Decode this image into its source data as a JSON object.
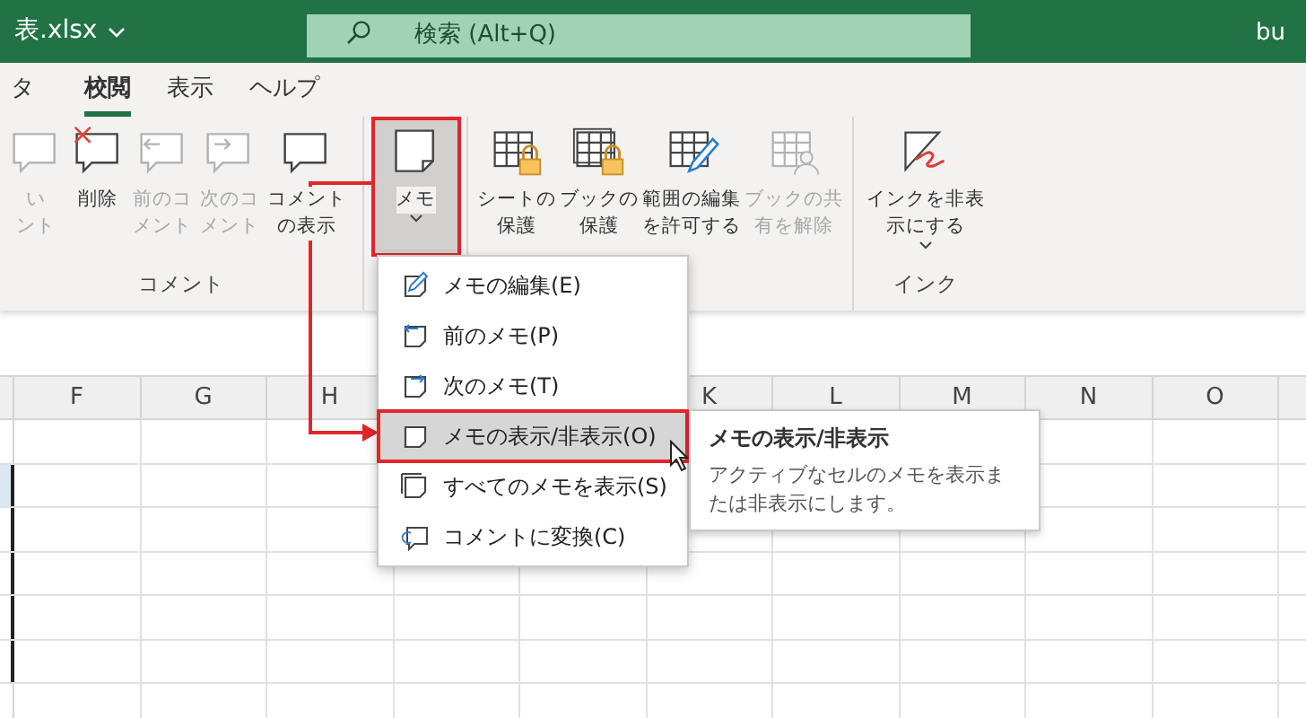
{
  "title_bar": {
    "file_name": "表.xlsx",
    "search": {
      "placeholder": "検索 (Alt+Q)"
    },
    "user": "bu"
  },
  "tabs": [
    {
      "label": "タ",
      "selected": false
    },
    {
      "label": "校閲",
      "selected": true
    },
    {
      "label": "表示",
      "selected": false
    },
    {
      "label": "ヘルプ",
      "selected": false
    }
  ],
  "ribbon_groups": [
    {
      "label": "コメント",
      "buttons": [
        {
          "kind": "comment-new",
          "lines": [
            "い",
            "ント"
          ],
          "disabled": true,
          "pressed": false,
          "dropdown": false
        },
        {
          "kind": "comment-delete",
          "lines": [
            "削除"
          ],
          "disabled": false,
          "pressed": false,
          "dropdown": false
        },
        {
          "kind": "comment-prev",
          "lines": [
            "前のコ",
            "メント"
          ],
          "disabled": true,
          "pressed": false,
          "dropdown": false
        },
        {
          "kind": "comment-next",
          "lines": [
            "次のコ",
            "メント"
          ],
          "disabled": true,
          "pressed": false,
          "dropdown": false
        },
        {
          "kind": "comment",
          "lines": [
            "コメント",
            "の表示"
          ],
          "disabled": false,
          "pressed": false,
          "dropdown": false
        }
      ]
    },
    {
      "buttons": [
        {
          "kind": "note",
          "lines": [
            "メモ"
          ],
          "disabled": false,
          "pressed": true,
          "dropdown": true
        }
      ]
    },
    {
      "buttons": [
        {
          "kind": "sheet-lock",
          "lines": [
            "シートの",
            "保護"
          ],
          "disabled": false,
          "pressed": false,
          "dropdown": false
        },
        {
          "kind": "book-lock",
          "lines": [
            "ブックの",
            "保護"
          ],
          "disabled": false,
          "pressed": false,
          "dropdown": false
        },
        {
          "kind": "range-edit",
          "lines": [
            "範囲の編集",
            "を許可する"
          ],
          "disabled": false,
          "pressed": false,
          "dropdown": false
        },
        {
          "kind": "book-share",
          "lines": [
            "ブックの共",
            "有を解除"
          ],
          "disabled": true,
          "pressed": false,
          "dropdown": false
        }
      ]
    },
    {
      "label": "インク",
      "buttons": [
        {
          "kind": "ink",
          "lines": [
            "インクを非表",
            "示にする"
          ],
          "disabled": false,
          "pressed": false,
          "dropdown": true
        }
      ]
    }
  ],
  "memo_menu": [
    {
      "kind": "edit",
      "label": "メモの編集(E)",
      "selected": false
    },
    {
      "kind": "prev",
      "label": "前のメモ(P)",
      "selected": false
    },
    {
      "kind": "next",
      "label": "次のメモ(T)",
      "selected": false
    },
    {
      "kind": "note",
      "label": "メモの表示/非表示(O)",
      "selected": true
    },
    {
      "kind": "notes",
      "label": "すべてのメモを表示(S)",
      "selected": false
    },
    {
      "kind": "convert",
      "label": "コメントに変換(C)",
      "selected": false
    }
  ],
  "tooltip": {
    "title": "メモの表示/非表示",
    "description": "アクティブなセルのメモを表示または非表示にします。"
  },
  "sheet": {
    "columns_left": [
      "F",
      "G",
      "H"
    ],
    "columns_right": [
      "K",
      "L",
      "M",
      "N",
      "O"
    ]
  }
}
